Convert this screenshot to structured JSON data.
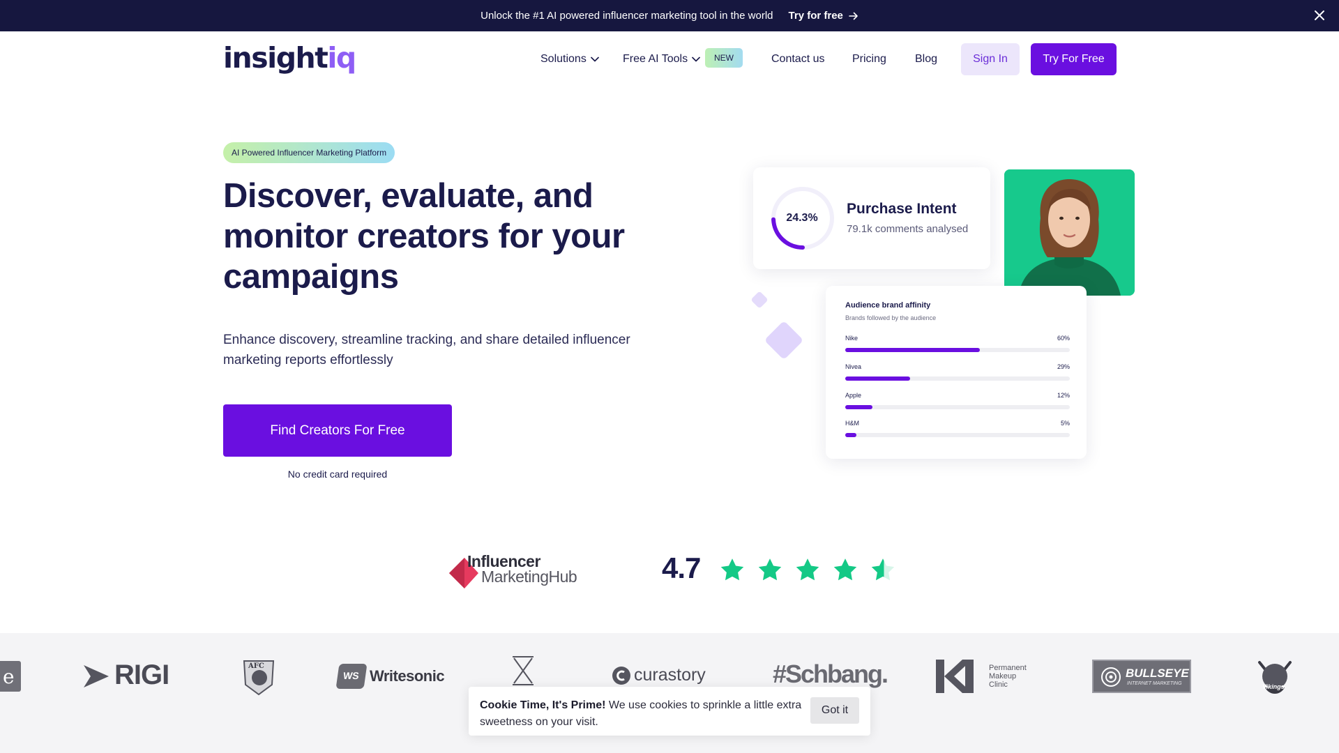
{
  "announcement": {
    "message": "Unlock the #1 AI powered influencer marketing tool in the world",
    "cta_label": "Try for free"
  },
  "header": {
    "logo_main": "insight",
    "logo_accent": "iq",
    "nav": {
      "solutions": "Solutions",
      "free_ai_tools": "Free AI Tools",
      "new_badge": "NEW",
      "contact": "Contact us",
      "pricing": "Pricing",
      "blog": "Blog"
    },
    "sign_in": "Sign In",
    "try_free": "Try For Free"
  },
  "hero": {
    "pill": "AI Powered Influencer Marketing Platform",
    "title": "Discover, evaluate, and monitor creators for your campaigns",
    "subtitle": "Enhance discovery, streamline tracking, and share detailed influencer marketing reports effortlessly",
    "cta": "Find Creators For Free",
    "cta_note": "No credit card required"
  },
  "visual": {
    "intent": {
      "percent_label": "24.3%",
      "percent_value": 24.3,
      "title": "Purchase Intent",
      "subtitle": "79.1k comments analysed"
    },
    "affinity": {
      "title": "Audience brand affinity",
      "subtitle": "Brands followed by the audience",
      "brands": [
        {
          "name": "Nike",
          "pct_label": "60%",
          "value": 60
        },
        {
          "name": "Nivea",
          "pct_label": "29%",
          "value": 29
        },
        {
          "name": "Apple",
          "pct_label": "12%",
          "value": 12
        },
        {
          "name": "H&M",
          "pct_label": "5%",
          "value": 5
        }
      ]
    }
  },
  "rating": {
    "source_line1": "Influencer",
    "source_line2": "MarketingHub",
    "score": "4.7",
    "stars_value": 4.7
  },
  "logos": {
    "rigi": "RIGI",
    "afc": "AFC",
    "writesonic": "Writesonic",
    "ws_mark": "WS",
    "curastory": "curastory",
    "schbang": "#Schbang.",
    "pmc_line1": "Permanent",
    "pmc_line2": "Makeup",
    "pmc_line3": "Clinic",
    "bullseye": "BULLSEYE",
    "bullseye_sub": "INTERNET MARKETING",
    "vikings": "Vikings"
  },
  "cookie": {
    "bold": "Cookie Time, It's Prime!",
    "text": " We use cookies to sprinkle a little extra sweetness on your visit.",
    "button": "Got it"
  },
  "colors": {
    "brand_purple": "#6a0fe0",
    "accent_violet": "#8e5ef5",
    "navy": "#16173f",
    "star_green": "#14c986",
    "photo_green": "#17c98c"
  }
}
